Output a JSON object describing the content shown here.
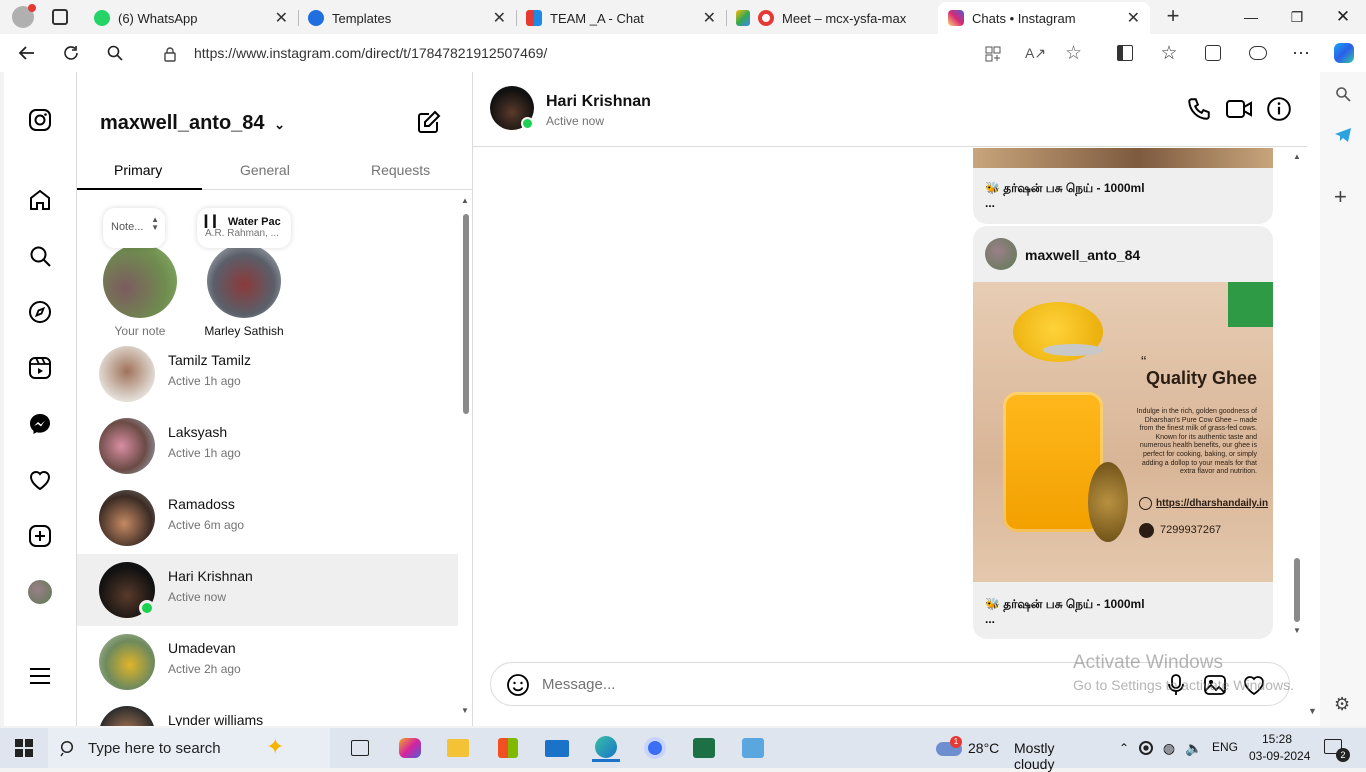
{
  "browser": {
    "tabs": [
      {
        "title": "(6) WhatsApp",
        "color": "#25d366"
      },
      {
        "title": "Templates",
        "color": "#1f6fe0"
      },
      {
        "title": "TEAM _A - Chat",
        "color": "#e53935"
      },
      {
        "title": "Meet – mcx-ysfa-max",
        "color": "#e53935"
      },
      {
        "title": "Chats • Instagram",
        "color": "#d6249f"
      }
    ],
    "url": "https://www.instagram.com/direct/t/17847821912507469/"
  },
  "inbox": {
    "username": "maxwell_anto_84",
    "tabs": [
      "Primary",
      "General",
      "Requests"
    ],
    "notes": [
      {
        "bubble": "Note...",
        "label": "Your note"
      },
      {
        "bubble_title": "Water Pac",
        "bubble_sub": "A.R. Rahman, ...",
        "label": "Marley Sathish"
      }
    ],
    "conversations": [
      {
        "name": "Tamilz Tamilz",
        "status": "Active 1h ago"
      },
      {
        "name": "Laksyash",
        "status": "Active 1h ago"
      },
      {
        "name": "Ramadoss",
        "status": "Active 6m ago"
      },
      {
        "name": "Hari Krishnan",
        "status": "Active now"
      },
      {
        "name": "Umadevan",
        "status": "Active 2h ago"
      },
      {
        "name": "Lynder williams",
        "status": ""
      }
    ]
  },
  "chat": {
    "contact_name": "Hari Krishnan",
    "contact_status": "Active now",
    "post_author": "maxwell_anto_84",
    "caption_1": "🐝 தர்ஷன் பசு நெய் - 1000ml",
    "caption_1_more": "...",
    "caption_2": "🐝 தர்ஷன் பசு நெய் - 1000ml",
    "caption_2_more": "...",
    "post": {
      "quote": "“",
      "headline": "Quality Ghee",
      "body": "Indulge in the rich, golden goodness of Dharshan's Pure Cow Ghee – made from the finest milk of grass-fed cows. Known for its authentic taste and numerous health benefits, our ghee is perfect for cooking, baking, or simply adding a dollop to your meals for that extra flavor and nutrition.",
      "link": "https://dharshandaily.in",
      "phone": "7299937267"
    },
    "message_placeholder": "Message..."
  },
  "watermark": {
    "title": "Activate Windows",
    "sub": "Go to Settings to activate Windows."
  },
  "taskbar": {
    "search_placeholder": "Type here to search",
    "weather_temp": "28°C",
    "weather_text": "Mostly cloudy",
    "weather_badge": "1",
    "lang": "ENG",
    "time": "15:28",
    "date": "03-09-2024",
    "notif_count": "2"
  }
}
